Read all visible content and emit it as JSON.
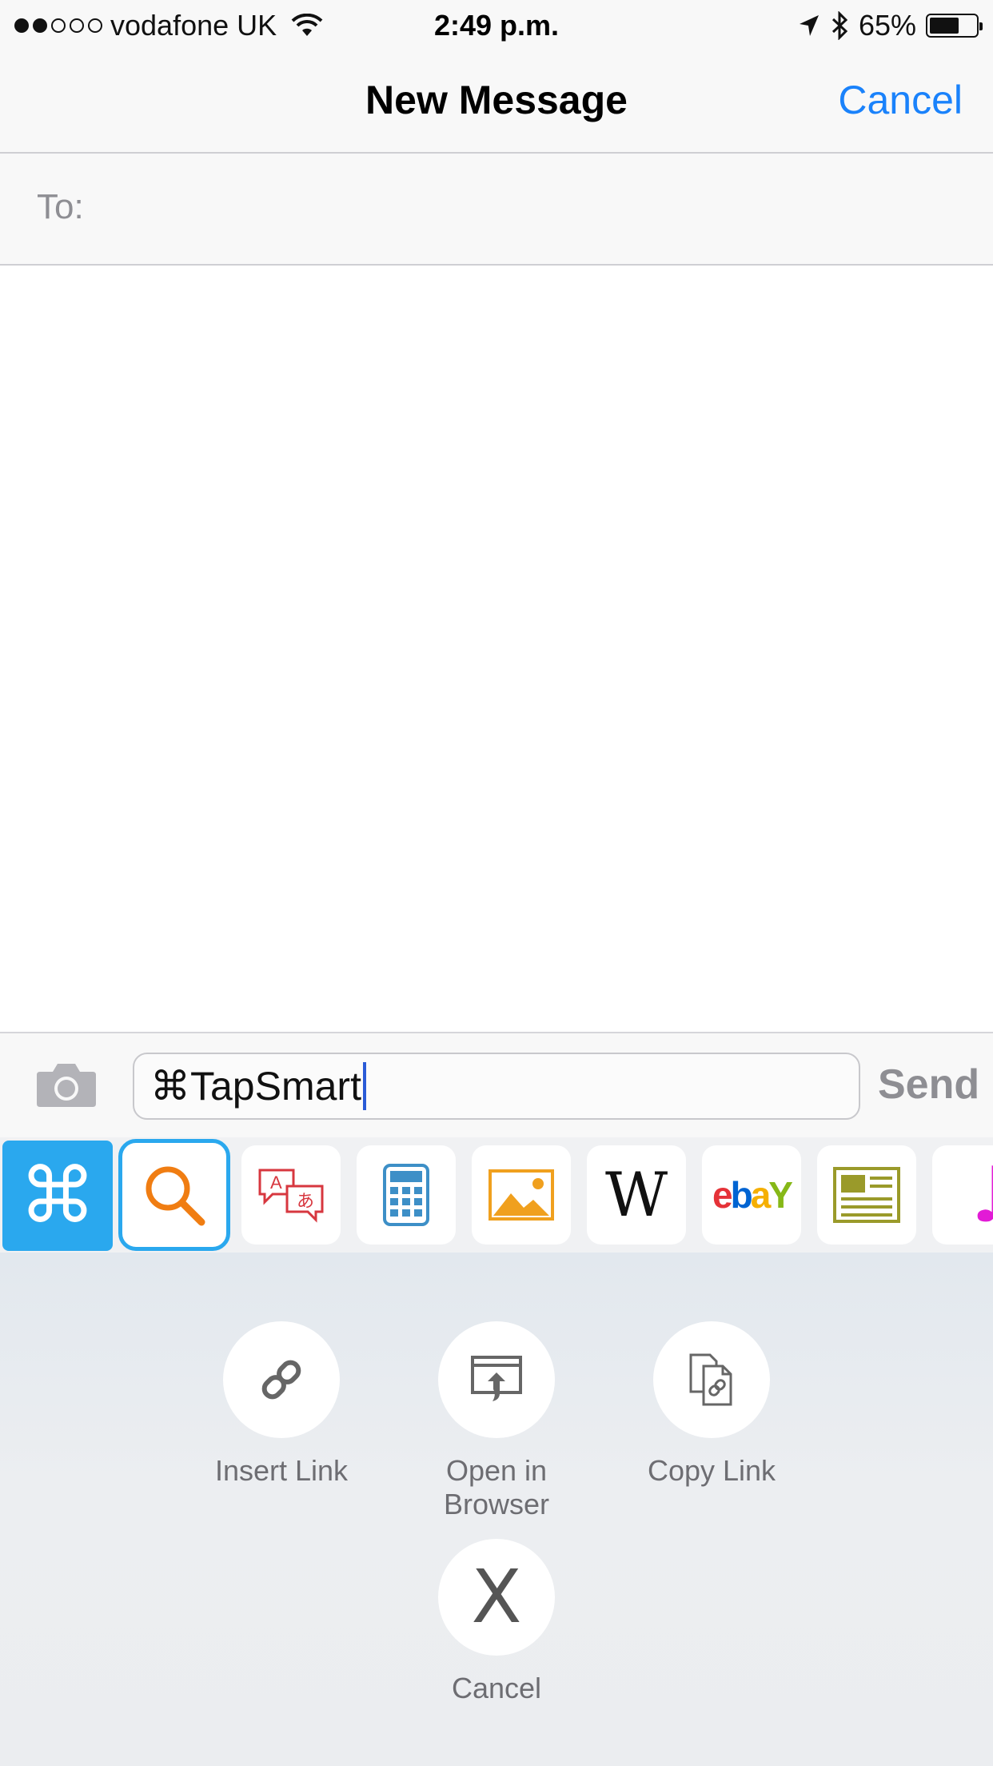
{
  "status_bar": {
    "carrier": "vodafone UK",
    "signal_bars_filled": 2,
    "signal_bars_total": 5,
    "time": "2:49 p.m.",
    "battery": "65%",
    "battery_level": 0.65
  },
  "nav": {
    "title": "New Message",
    "cancel": "Cancel"
  },
  "to_field": {
    "label": "To:"
  },
  "compose": {
    "text": "⌘TapSmart",
    "send": "Send"
  },
  "app_strip": {
    "command_glyph": "⌘",
    "wiki_glyph": "W",
    "ebay_letters": [
      "e",
      "b",
      "a",
      "Y"
    ],
    "ebay_colors": [
      "#e53238",
      "#0064d2",
      "#f5af02",
      "#86b817"
    ],
    "music_glyph": "♫"
  },
  "actions": {
    "insert_link": "Insert Link",
    "open_in_browser_line1": "Open in",
    "open_in_browser_line2": "Browser",
    "copy_link": "Copy Link",
    "cancel_glyph": "X",
    "cancel": "Cancel"
  },
  "colors": {
    "accent_blue": "#1a82fb",
    "strip_blue": "#2aa8ee",
    "search_orange": "#f07d12",
    "translate_red": "#d7373f",
    "calculator_blue": "#3d8fc7",
    "photos_orange": "#f0a01e",
    "news_olive": "#9a9a2a",
    "music_magenta": "#e21bd6"
  }
}
